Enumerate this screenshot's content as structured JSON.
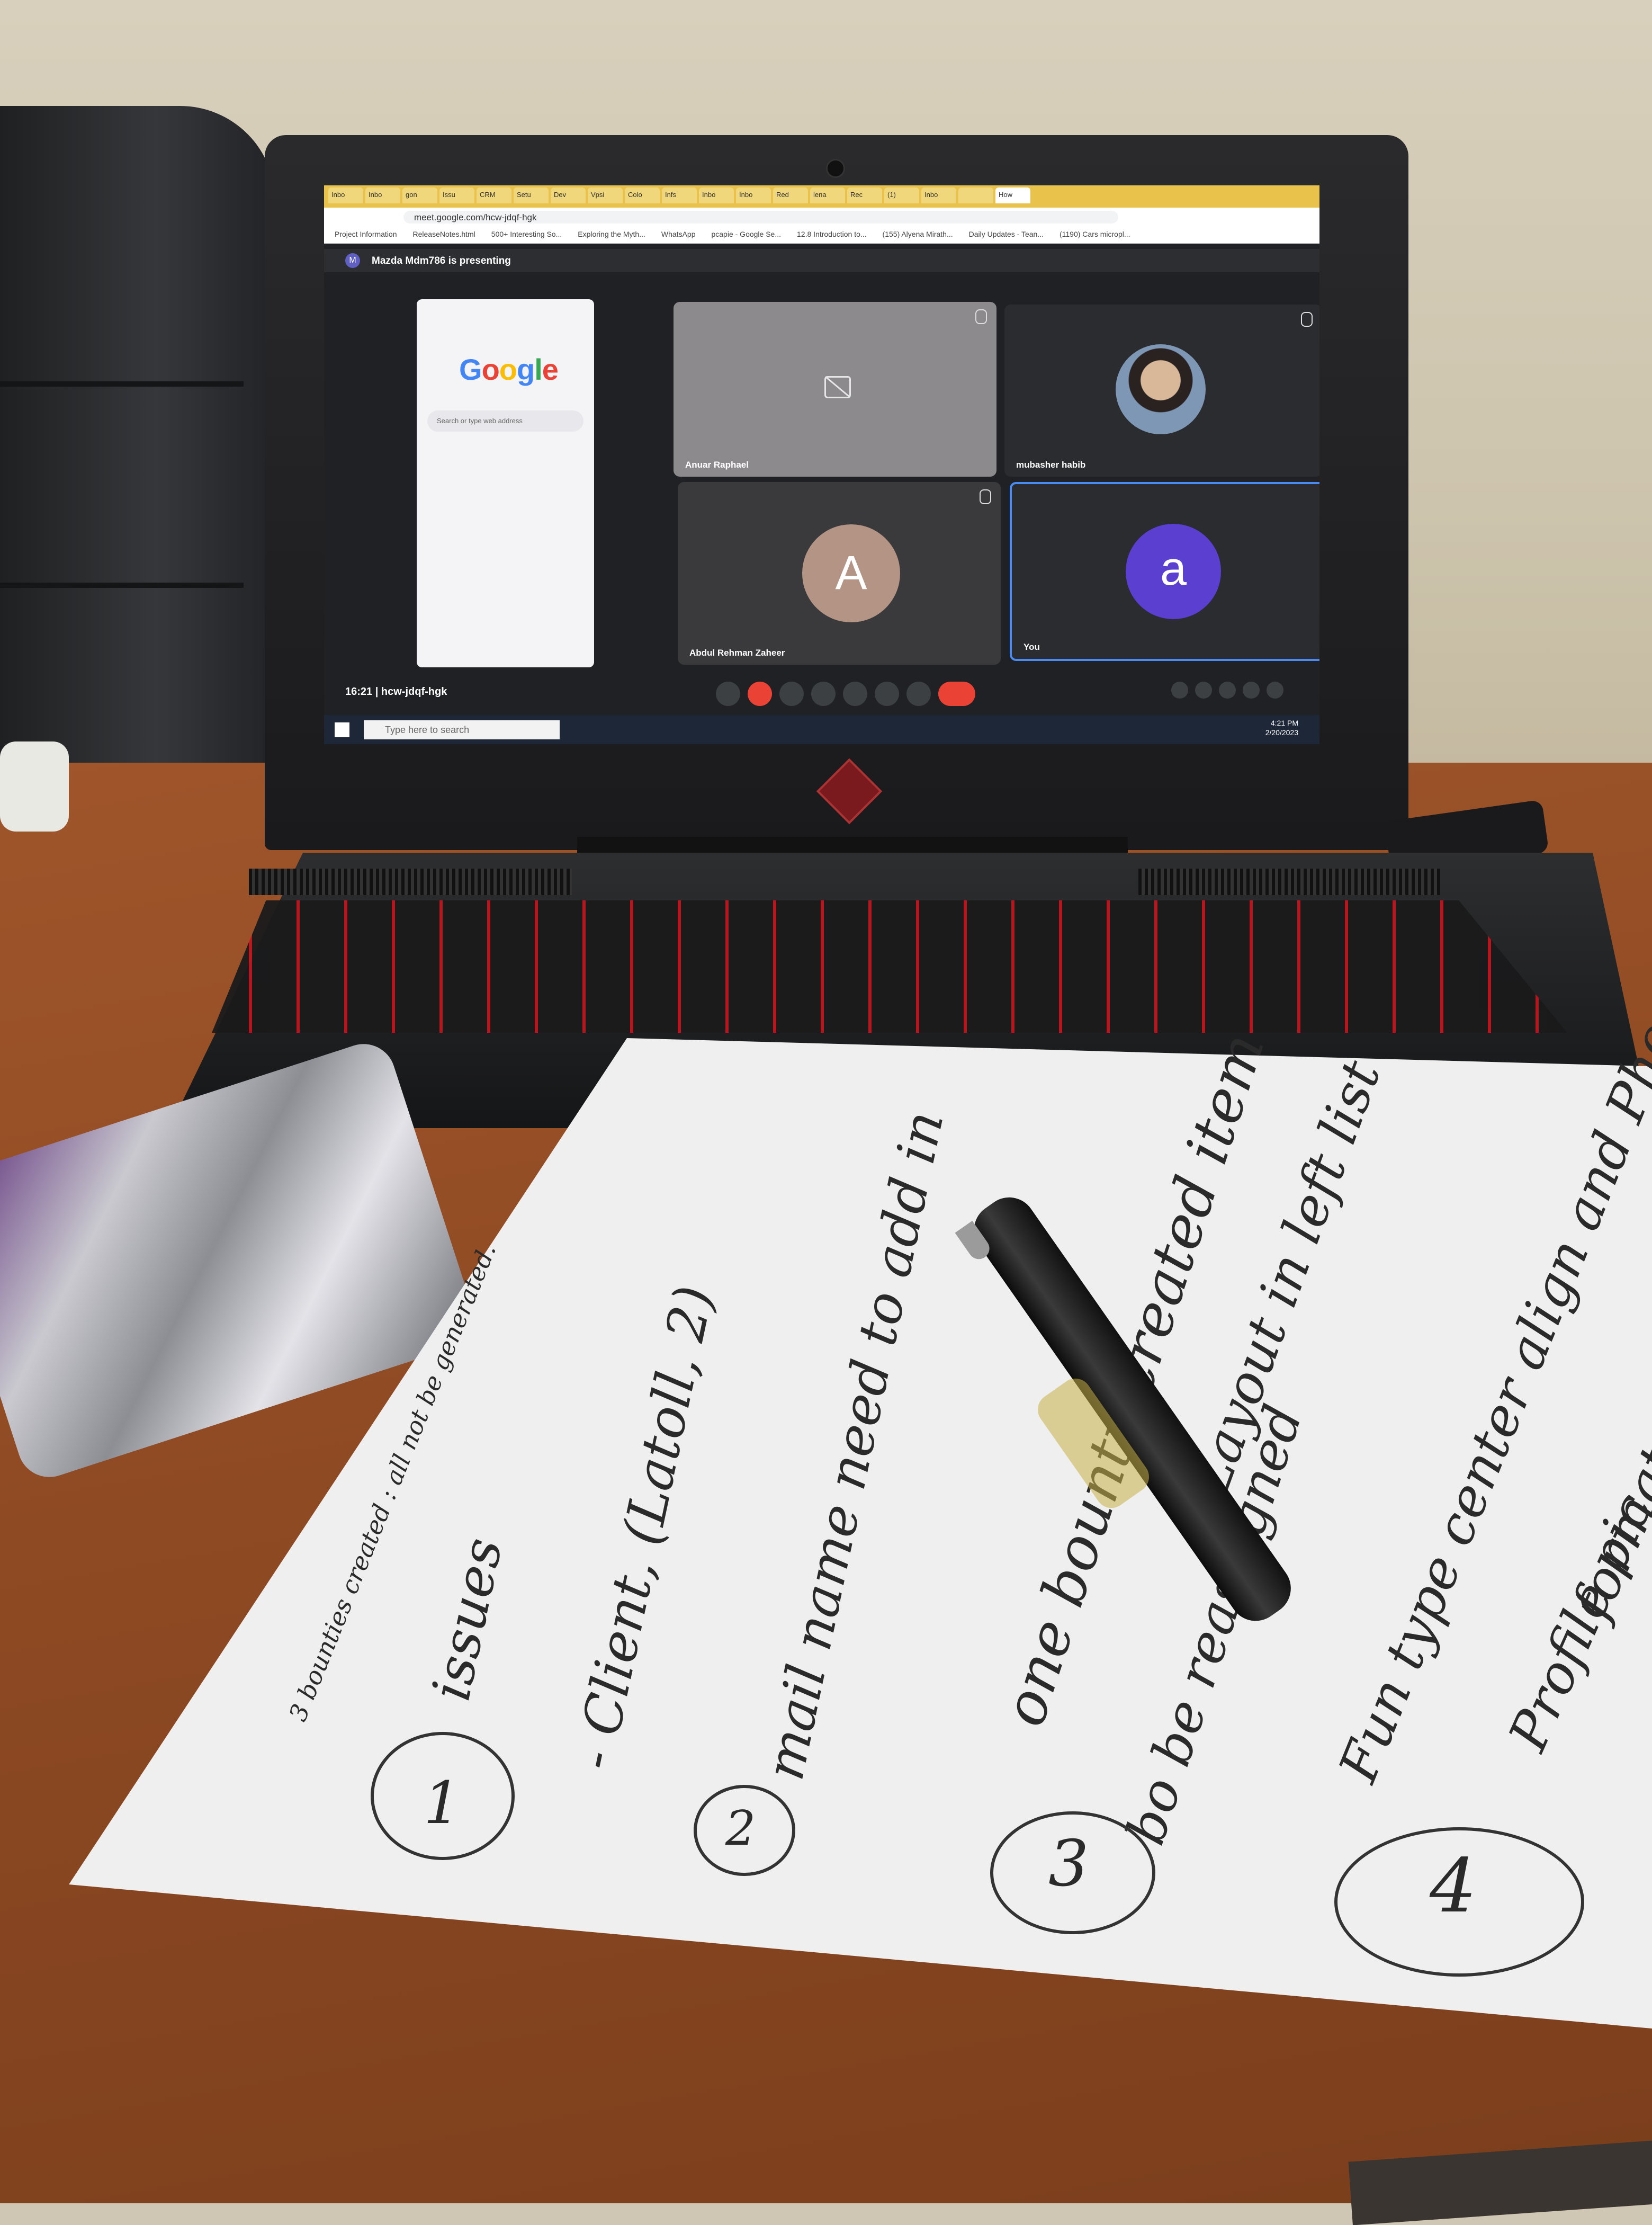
{
  "browser": {
    "tabs": [
      "Inbo",
      "Inbo",
      "gon",
      "Issu",
      "CRM",
      "Setu",
      "Dev",
      "Vpsi",
      "Colo",
      "Infs",
      "Inbo",
      "Inbo",
      "Red",
      "lena",
      "Rec",
      "(1)",
      "Inbo",
      "",
      "How"
    ],
    "url": "meet.google.com/hcw-jdqf-hgk",
    "bookmarks": [
      "Project Information",
      "ReleaseNotes.html",
      "500+ Interesting So...",
      "Exploring the Myth...",
      "WhatsApp",
      "pcapie - Google Se...",
      "12.8 Introduction to...",
      "(155) Alyena Mirath...",
      "Daily Updates - Tean...",
      "(1190) Cars micropl..."
    ]
  },
  "meet": {
    "presenting": "Mazda Mdm786 is presenting",
    "presenter_initial": "M",
    "participants": [
      {
        "name": "Anuar Raphael",
        "state": "camera-off-icon"
      },
      {
        "name": "mubasher habib",
        "state": "photo"
      },
      {
        "name": "Abdul Rehman Zaheer",
        "initial": "A",
        "color": "#b49484"
      },
      {
        "name": "You",
        "initial": "a",
        "color": "#5a3fd1"
      }
    ],
    "time": "16:21",
    "meeting_code": "hcw-jdqf-hgk",
    "time_sep": "|"
  },
  "phone_screen": {
    "logo": "Google",
    "search_placeholder": "Search or type web address"
  },
  "windows": {
    "search_placeholder": "Type here to search",
    "clock_time": "4:21 PM",
    "clock_date": "2/20/2023"
  },
  "notes": {
    "item1_num": "1",
    "item1_a": "issues",
    "item1_b": "- Client, (Latoll, 2)",
    "item1_c": "mail name need to add in",
    "item2_num": "2",
    "item2_a": "one bounty created item",
    "item2_b": "bo be reassigned",
    "item3_num": "3",
    "item3_a": "Layout in left list",
    "item3_b": "Fun type center align and Phone",
    "item4_num": "4",
    "item4_a": "Profile pic",
    "item4_b": "format",
    "header": "3 bounties created : all not be generated."
  },
  "colors": {
    "tab_bar": "#e9c24c",
    "meet_dark": "#202124",
    "active_tile_border": "#4a8af4",
    "keyboard_backlight": "#c0161f"
  }
}
